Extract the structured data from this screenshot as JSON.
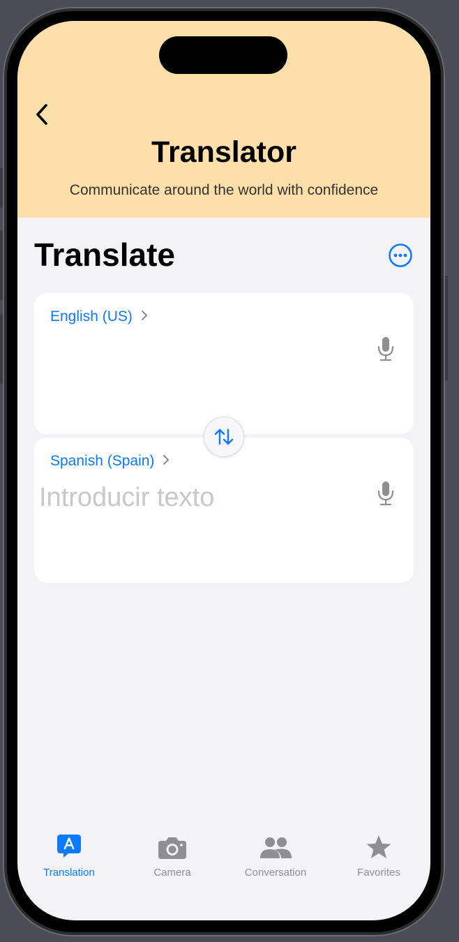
{
  "header": {
    "title": "Translator",
    "subtitle": "Communicate around the world with confidence"
  },
  "main": {
    "title": "Translate",
    "source": {
      "language": "English (US)",
      "text": ""
    },
    "target": {
      "language": "Spanish (Spain)",
      "placeholder": "Introducir texto"
    }
  },
  "tabs": [
    {
      "label": "Translation",
      "icon": "translate-bubble-icon",
      "active": true
    },
    {
      "label": "Camera",
      "icon": "camera-icon",
      "active": false
    },
    {
      "label": "Conversation",
      "icon": "people-icon",
      "active": false
    },
    {
      "label": "Favorites",
      "icon": "star-icon",
      "active": false
    }
  ],
  "colors": {
    "header_bg": "#fddfaa",
    "accent": "#0a7aff",
    "page_bg": "#f2f2f7",
    "inactive": "#8e8e93"
  }
}
